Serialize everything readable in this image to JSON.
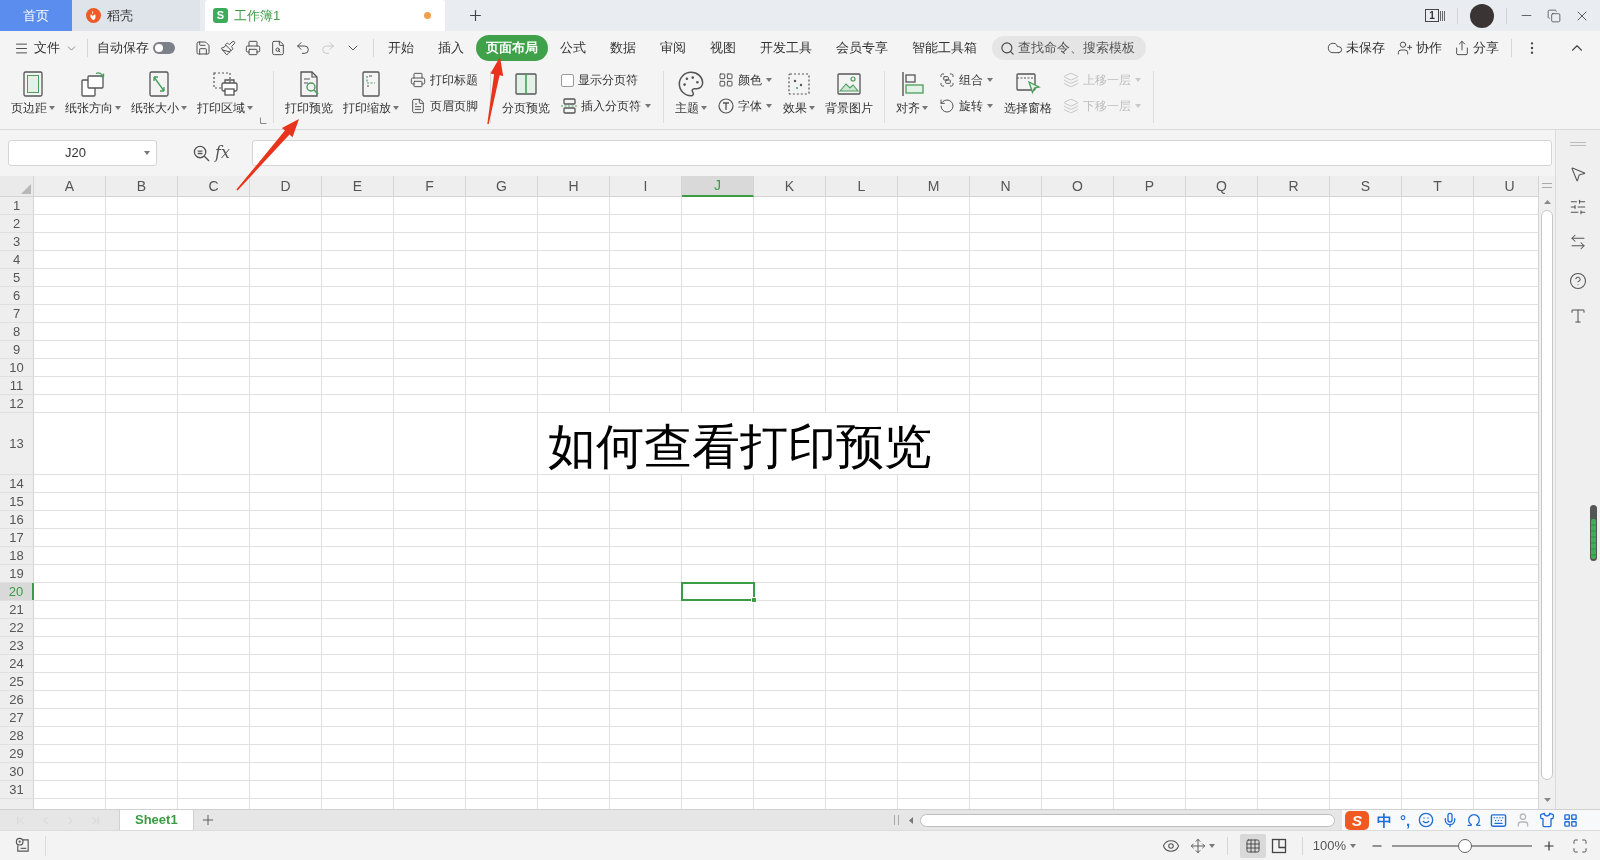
{
  "tabs": [
    {
      "kind": "home",
      "label": "首页",
      "selected": false
    },
    {
      "kind": "docer",
      "label": "稻壳",
      "selected": false
    },
    {
      "kind": "workbook",
      "label": "工作簿1",
      "logo_text": "S",
      "selected": true,
      "unsaved": true
    }
  ],
  "title_bar": {
    "window_count": "1"
  },
  "menu": {
    "file": "文件",
    "autosave": {
      "label": "自动保存",
      "on": false
    },
    "quick_access": [
      {
        "disabled": false
      },
      {
        "disabled": false
      },
      {
        "disabled": false
      },
      {
        "disabled": false
      },
      {
        "disabled": false
      },
      {
        "disabled": true
      },
      {
        "disabled": false
      }
    ],
    "tabs": [
      {
        "label": "开始",
        "selected": false
      },
      {
        "label": "插入",
        "selected": false
      },
      {
        "label": "页面布局",
        "selected": true
      },
      {
        "label": "公式",
        "selected": false
      },
      {
        "label": "数据",
        "selected": false
      },
      {
        "label": "审阅",
        "selected": false
      },
      {
        "label": "视图",
        "selected": false
      },
      {
        "label": "开发工具",
        "selected": false
      },
      {
        "label": "会员专享",
        "selected": false
      },
      {
        "label": "智能工具箱",
        "selected": false
      }
    ],
    "search": {
      "placeholder": "查找命令、搜索模板"
    },
    "actions": [
      {
        "label": "未保存"
      },
      {
        "label": "协作"
      },
      {
        "label": "分享"
      }
    ]
  },
  "ribbon": {
    "groups": [
      {
        "launcher": true,
        "columns": [
          {
            "kind": "large",
            "label": "页边距",
            "dropdown": true,
            "disabled": false
          },
          {
            "kind": "large",
            "label": "纸张方向",
            "dropdown": true,
            "disabled": false
          },
          {
            "kind": "large",
            "label": "纸张大小",
            "dropdown": true,
            "disabled": false
          },
          {
            "kind": "large",
            "label": "打印区域",
            "dropdown": true,
            "disabled": false
          }
        ]
      },
      {
        "launcher": false,
        "columns": [
          {
            "kind": "large",
            "label": "打印预览",
            "dropdown": false,
            "disabled": false
          },
          {
            "kind": "large",
            "label": "打印缩放",
            "dropdown": true,
            "disabled": false
          },
          {
            "kind": "stack",
            "items": [
              {
                "kind": "button",
                "label": "打印标题",
                "dropdown": false,
                "disabled": false
              },
              {
                "kind": "button",
                "label": "页眉页脚",
                "dropdown": false,
                "disabled": false
              }
            ]
          }
        ]
      },
      {
        "launcher": false,
        "columns": [
          {
            "kind": "large",
            "label": "分页预览",
            "dropdown": false,
            "disabled": false
          },
          {
            "kind": "stack",
            "items": [
              {
                "kind": "checkbox",
                "label": "显示分页符",
                "checked": false
              },
              {
                "kind": "button",
                "label": "插入分页符",
                "dropdown": true,
                "disabled": false
              }
            ]
          }
        ]
      },
      {
        "launcher": false,
        "columns": [
          {
            "kind": "large",
            "label": "主题",
            "dropdown": true,
            "disabled": false
          },
          {
            "kind": "stack",
            "items": [
              {
                "kind": "button",
                "label": "颜色",
                "dropdown": true,
                "disabled": false
              },
              {
                "kind": "button",
                "label": "字体",
                "dropdown": true,
                "disabled": false
              }
            ]
          },
          {
            "kind": "large",
            "label": "效果",
            "dropdown": true,
            "disabled": false
          },
          {
            "kind": "large",
            "label": "背景图片",
            "dropdown": false,
            "disabled": false
          }
        ]
      },
      {
        "launcher": false,
        "columns": [
          {
            "kind": "large",
            "label": "对齐",
            "dropdown": true,
            "disabled": false
          },
          {
            "kind": "stack",
            "items": [
              {
                "kind": "button",
                "label": "组合",
                "dropdown": true,
                "disabled": false
              },
              {
                "kind": "button",
                "label": "旋转",
                "dropdown": true,
                "disabled": false
              }
            ]
          },
          {
            "kind": "large",
            "label": "选择窗格",
            "dropdown": false,
            "disabled": false
          },
          {
            "kind": "stack",
            "items": [
              {
                "kind": "button",
                "label": "上移一层",
                "dropdown": true,
                "disabled": true
              },
              {
                "kind": "button",
                "label": "下移一层",
                "dropdown": true,
                "disabled": true
              }
            ]
          }
        ]
      }
    ]
  },
  "formula_bar": {
    "name_box": "J20",
    "fx": "fx"
  },
  "sheet": {
    "columns": [
      {
        "label": "A",
        "selected": false
      },
      {
        "label": "B",
        "selected": false
      },
      {
        "label": "C",
        "selected": false
      },
      {
        "label": "D",
        "selected": false
      },
      {
        "label": "E",
        "selected": false
      },
      {
        "label": "F",
        "selected": false
      },
      {
        "label": "G",
        "selected": false
      },
      {
        "label": "H",
        "selected": false
      },
      {
        "label": "I",
        "selected": false
      },
      {
        "label": "J",
        "selected": true
      },
      {
        "label": "K",
        "selected": false
      },
      {
        "label": "L",
        "selected": false
      },
      {
        "label": "M",
        "selected": false
      },
      {
        "label": "N",
        "selected": false
      },
      {
        "label": "O",
        "selected": false
      },
      {
        "label": "P",
        "selected": false
      },
      {
        "label": "Q",
        "selected": false
      },
      {
        "label": "R",
        "selected": false
      },
      {
        "label": "S",
        "selected": false
      },
      {
        "label": "T",
        "selected": false
      },
      {
        "label": "U",
        "selected": false
      }
    ],
    "rows": [
      {
        "label": "1",
        "selected": false
      },
      {
        "label": "2",
        "selected": false
      },
      {
        "label": "3",
        "selected": false
      },
      {
        "label": "4",
        "selected": false
      },
      {
        "label": "5",
        "selected": false
      },
      {
        "label": "6",
        "selected": false
      },
      {
        "label": "7",
        "selected": false
      },
      {
        "label": "8",
        "selected": false
      },
      {
        "label": "9",
        "selected": false
      },
      {
        "label": "10",
        "selected": false
      },
      {
        "label": "11",
        "selected": false
      },
      {
        "label": "12",
        "selected": false
      },
      {
        "label": "13",
        "selected": false,
        "text": "如何查看打印预览"
      },
      {
        "label": "14",
        "selected": false
      },
      {
        "label": "15",
        "selected": false
      },
      {
        "label": "16",
        "selected": false
      },
      {
        "label": "17",
        "selected": false
      },
      {
        "label": "18",
        "selected": false
      },
      {
        "label": "19",
        "selected": false
      },
      {
        "label": "20",
        "selected": true
      },
      {
        "label": "21",
        "selected": false
      },
      {
        "label": "22",
        "selected": false
      },
      {
        "label": "23",
        "selected": false
      },
      {
        "label": "24",
        "selected": false
      },
      {
        "label": "25",
        "selected": false
      },
      {
        "label": "26",
        "selected": false
      },
      {
        "label": "27",
        "selected": false
      },
      {
        "label": "28",
        "selected": false
      },
      {
        "label": "29",
        "selected": false
      },
      {
        "label": "30",
        "selected": false
      },
      {
        "label": "31",
        "selected": false
      }
    ]
  },
  "sheet_bar": {
    "nav_disabled": true,
    "tabs": [
      {
        "label": "Sheet1",
        "selected": true
      }
    ]
  },
  "status_bar": {
    "view_modes": [
      {
        "selected": true
      },
      {
        "selected": false
      }
    ],
    "zoom": "100%",
    "zoom_slider": {
      "level": 0.52
    }
  },
  "ime_toolbar": {
    "logo_text": "S",
    "mode": "中",
    "punctuation": "°,"
  }
}
